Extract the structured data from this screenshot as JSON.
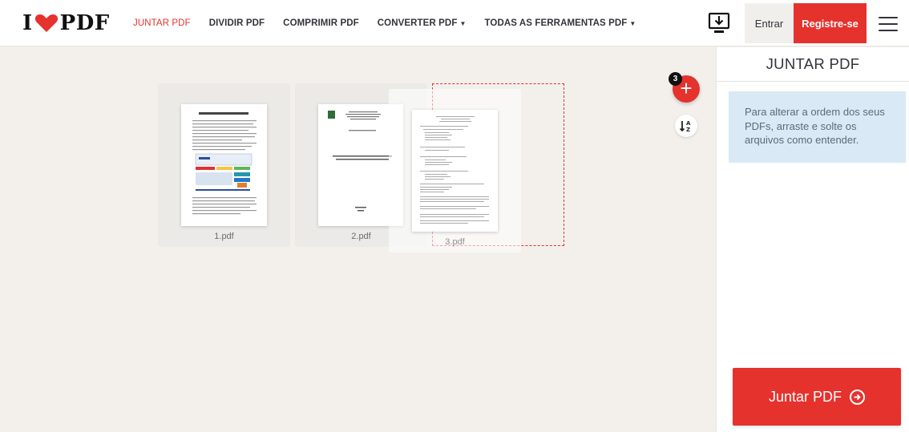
{
  "brand": {
    "logo_left": "I",
    "logo_right": "PDF",
    "accent": "#e5322d"
  },
  "nav": [
    {
      "label": "JUNTAR PDF",
      "active": true,
      "dropdown": false
    },
    {
      "label": "DIVIDIR PDF",
      "active": false,
      "dropdown": false
    },
    {
      "label": "COMPRIMIR PDF",
      "active": false,
      "dropdown": false
    },
    {
      "label": "CONVERTER PDF",
      "active": false,
      "dropdown": true
    },
    {
      "label": "TODAS AS FERRAMENTAS PDF",
      "active": false,
      "dropdown": true
    }
  ],
  "header": {
    "desktop_icon": "desktop-download-icon",
    "login_label": "Entrar",
    "register_label": "Registre-se",
    "menu_icon": "hamburger-menu-icon"
  },
  "files": [
    {
      "name": "1.pdf"
    },
    {
      "name": "2.pdf"
    },
    {
      "name": "3.pdf"
    }
  ],
  "add_button": {
    "icon": "plus-icon",
    "badge_count": "3"
  },
  "sort_button": {
    "icon": "sort-alpha-icon"
  },
  "sidebar": {
    "title": "JUNTAR PDF",
    "info": "Para alterar a ordem dos seus PDFs, arraste e solte os arquivos como entender.",
    "merge_label": "Juntar PDF",
    "merge_icon": "arrow-circle-right-icon"
  }
}
